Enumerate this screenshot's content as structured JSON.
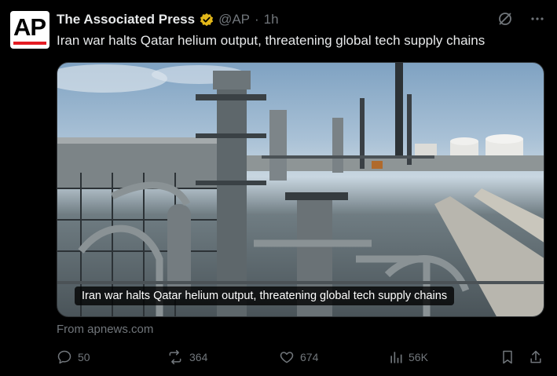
{
  "account": {
    "name": "The Associated Press",
    "handle": "@AP",
    "separator": "·",
    "time": "1h",
    "avatar_text": "AP",
    "verified_color": "#e2b719"
  },
  "tweet": {
    "text": "Iran war halts Qatar helium output, threatening global tech supply chains"
  },
  "media": {
    "caption": "Iran war halts Qatar helium output, threatening global tech supply chains",
    "description_icon": "industrial-plant-photo"
  },
  "card": {
    "source": "From apnews.com"
  },
  "actions": {
    "replies": "50",
    "reposts": "364",
    "likes": "674",
    "views": "56K"
  },
  "colors": {
    "background": "#000000",
    "text": "#e7e9ea",
    "muted": "#71767b",
    "ap_red": "#e41c23"
  }
}
